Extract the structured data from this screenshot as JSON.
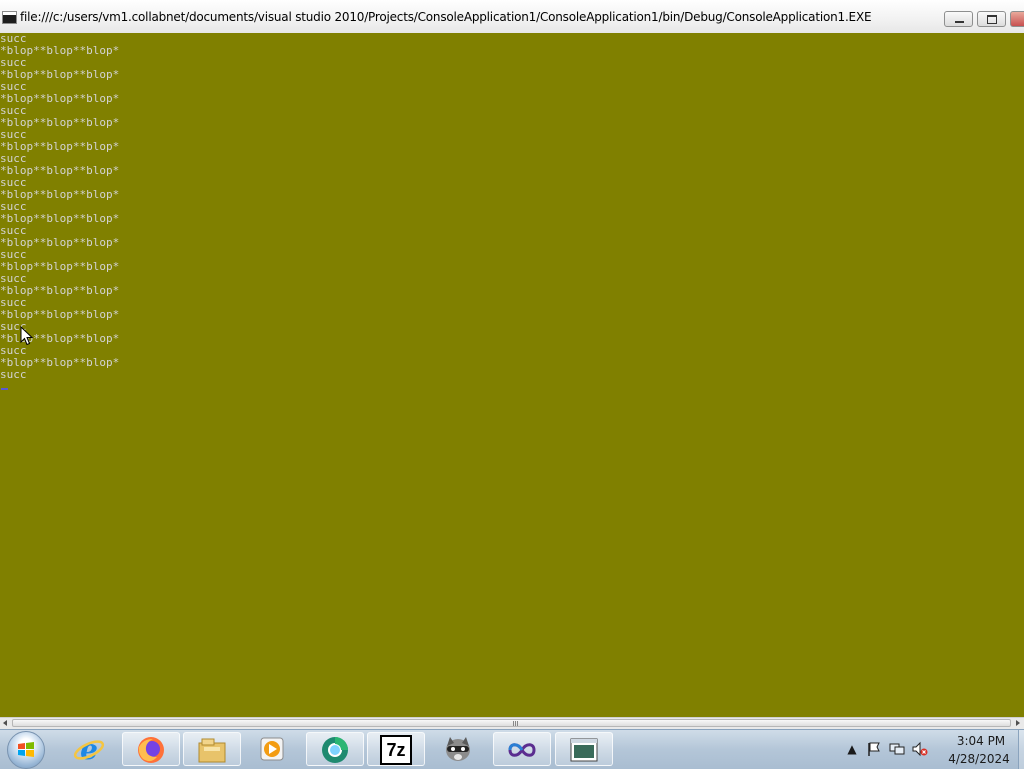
{
  "window": {
    "title": "file:///c:/users/vm1.collabnet/documents/visual studio 2010/Projects/ConsoleApplication1/ConsoleApplication1/bin/Debug/ConsoleApplication1.EXE",
    "icon": "console-app-icon",
    "controls": [
      "minimize-icon",
      "maximize-icon",
      "close-icon"
    ]
  },
  "console": {
    "background": "#808000",
    "foreground": "#d3d3d3",
    "output": "succ\n*blop**blop**blop*\nsucc\n*blop**blop**blop*\nsucc\n*blop**blop**blop*\nsucc\n*blop**blop**blop*\nsucc\n*blop**blop**blop*\nsucc\n*blop**blop**blop*\nsucc\n*blop**blop**blop*\nsucc\n*blop**blop**blop*\nsucc\n*blop**blop**blop*\nsucc\n*blop**blop**blop*\nsucc\n*blop**blop**blop*\nsucc\n*blop**blop**blop*\nsucc\n*blop**blop**blop*\nsucc\n*blop**blop**blop*\nsucc"
  },
  "taskbar": {
    "start_icon": "windows-start-orb-icon",
    "items": [
      {
        "name": "internet-explorer-icon"
      },
      {
        "name": "firefox-icon"
      },
      {
        "name": "file-explorer-icon"
      },
      {
        "name": "media-player-icon"
      },
      {
        "name": "chrome-like-app-icon"
      },
      {
        "name": "7zip-icon",
        "label": "7z"
      },
      {
        "name": "raccoon-app-icon"
      },
      {
        "name": "visual-studio-icon"
      },
      {
        "name": "console-window-icon"
      }
    ],
    "tray": {
      "icons": [
        "show-hidden-icons-icon",
        "action-center-flag-icon",
        "network-icon",
        "volume-muted-icon"
      ],
      "time": "3:04 PM",
      "date": "4/28/2024"
    }
  }
}
